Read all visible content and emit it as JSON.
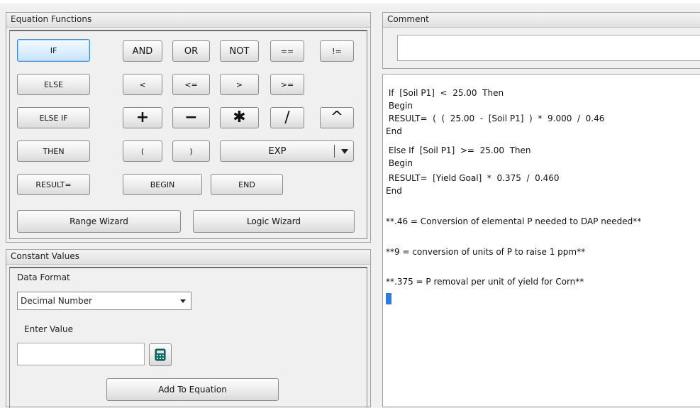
{
  "equation_functions": {
    "title": "Equation Functions",
    "buttons": {
      "if": "IF",
      "and": "AND",
      "or": "OR",
      "not": "NOT",
      "eq": "==",
      "neq": "!=",
      "else": "ELSE",
      "lt": "<",
      "lte": "<=",
      "gt": ">",
      "gte": ">=",
      "else_if": "ELSE IF",
      "plus": "+",
      "minus": "−",
      "multiply": "✱",
      "divide": "∕",
      "power": "^",
      "then": "THEN",
      "open_paren": "(",
      "close_paren": ")",
      "exp": "EXP",
      "result": "RESULT=",
      "begin": "BEGIN",
      "end": "END",
      "range_wizard": "Range Wizard",
      "logic_wizard": "Logic Wizard"
    }
  },
  "constant_values": {
    "title": "Constant Values",
    "data_format_label": "Data Format",
    "data_format_selected": "Decimal Number",
    "enter_value_label": "Enter Value",
    "value_input": "",
    "add_to_equation": "Add To Equation"
  },
  "comment": {
    "title": "Comment",
    "value": ""
  },
  "editor": {
    "lines": [
      " If  [Soil P1]  <  25.00  Then",
      " Begin",
      " RESULT=  (  (  25.00  -  [Soil P1]  )  *  9.000  /  0.46",
      "End",
      " Else If  [Soil P1]  >=  25.00  Then",
      " Begin",
      " RESULT=  [Yield Goal]  *  0.375  /  0.460",
      "End",
      "",
      "**.46 = Conversion of elemental P needed to DAP needed**",
      "",
      "**9 = conversion of units of P to raise 1 ppm**",
      "",
      "**.375 = P removal per unit of yield for Corn**"
    ]
  },
  "icons": {
    "calculator": "calculator-icon",
    "dropdown": "chevron-down-icon"
  },
  "colors": {
    "selected_button_border": "#3c8ad3",
    "cursor": "#2f7be0",
    "calculator": "#0f6b63"
  }
}
